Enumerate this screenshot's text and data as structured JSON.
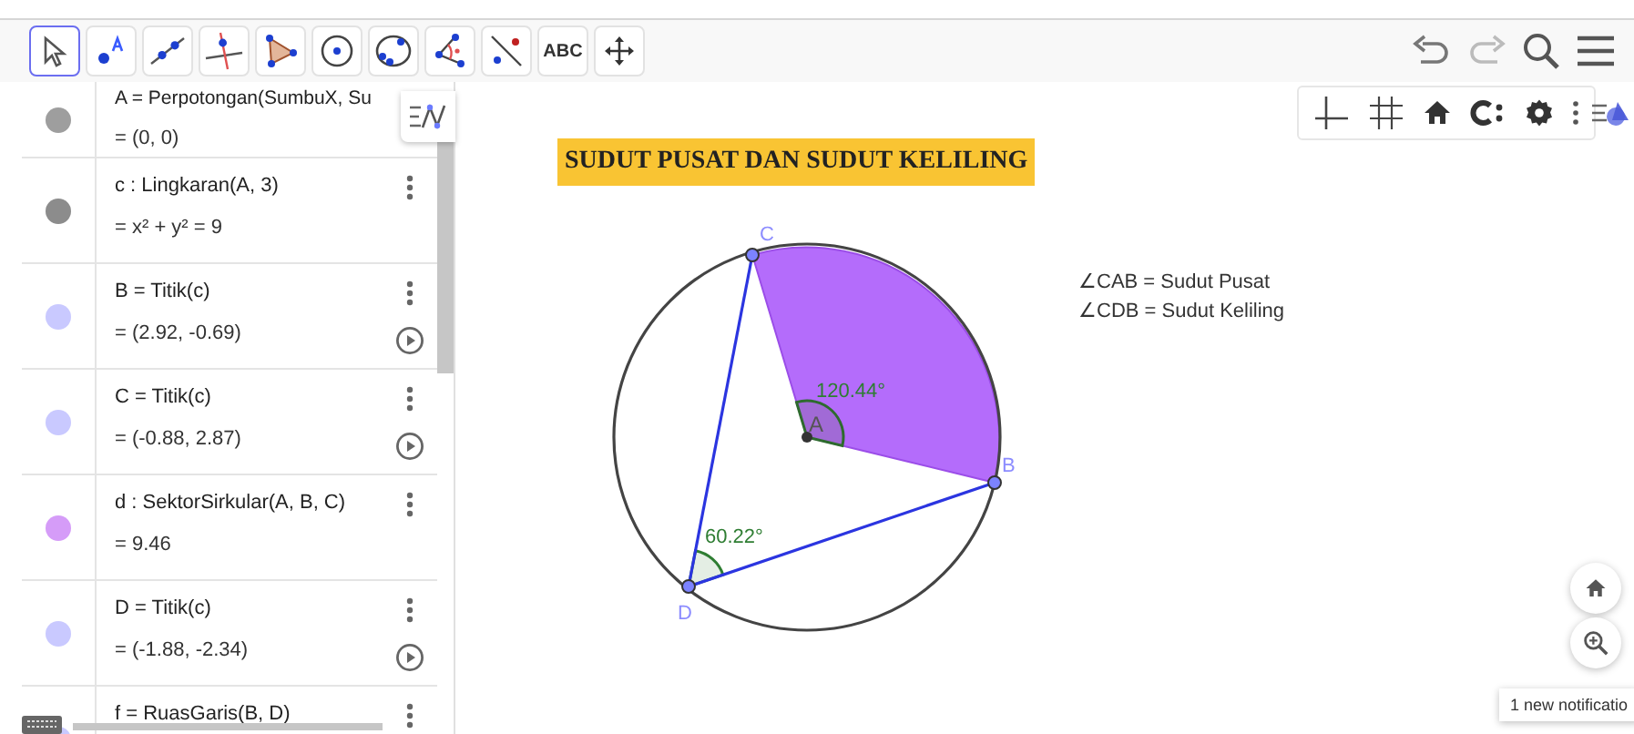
{
  "toolbar": {
    "tools": [
      {
        "kind": "move",
        "selected": true
      },
      {
        "kind": "point",
        "selected": false
      },
      {
        "kind": "line",
        "selected": false
      },
      {
        "kind": "perpendicular",
        "selected": false
      },
      {
        "kind": "polygon",
        "selected": false
      },
      {
        "kind": "circle",
        "selected": false
      },
      {
        "kind": "conic",
        "selected": false
      },
      {
        "kind": "angle",
        "selected": false
      },
      {
        "kind": "reflect",
        "selected": false
      },
      {
        "kind": "text",
        "label": "ABC",
        "selected": false
      },
      {
        "kind": "pan",
        "selected": false
      }
    ]
  },
  "algebra": {
    "items": [
      {
        "color": "#9e9e9e",
        "definition": "A = Perpotongan(SumbuX, Su",
        "value": "= (0, 0)",
        "play_button": false
      },
      {
        "color": "#8c8c8c",
        "definition": "c : Lingkaran(A, 3)",
        "value": "= x² + y² = 9",
        "play_button": false
      },
      {
        "color": "#c9c9ff",
        "definition": "B = Titik(c)",
        "value": "= (2.92, -0.69)",
        "play_button": true
      },
      {
        "color": "#c9c9ff",
        "definition": "C = Titik(c)",
        "value": "= (-0.88, 2.87)",
        "play_button": true
      },
      {
        "color": "#d59cf8",
        "definition": "d : SektorSirkular(A, B, C)",
        "value": "= 9.46",
        "play_button": false
      },
      {
        "color": "#c9c9ff",
        "definition": "D = Titik(c)",
        "value": "= (-1.88, -2.34)",
        "play_button": true
      },
      {
        "color": "#c9c9ff",
        "definition": "f = RuasGaris(B, D)",
        "value": "",
        "play_button": false
      }
    ]
  },
  "graphics": {
    "title": "SUDUT PUSAT DAN SUDUT KELILING",
    "legend": [
      "∠CAB = Sudut Pusat",
      "∠CDB = Sudut Keliling"
    ],
    "points": [
      "A",
      "B",
      "C",
      "D"
    ],
    "angles": [
      "120.44°",
      "60.22°"
    ]
  },
  "notification": "1 new notificatio"
}
